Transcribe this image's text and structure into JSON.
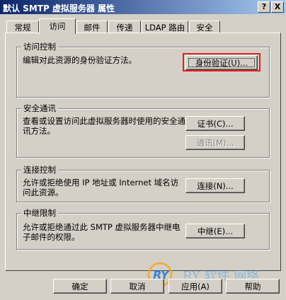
{
  "window": {
    "title": "默认 SMTP 虚拟服务器 属性",
    "help_btn": "?",
    "close_btn": "X"
  },
  "tabs": [
    "常规",
    "访问",
    "邮件",
    "传递",
    "LDAP 路由",
    "安全"
  ],
  "active_tab": "访问",
  "groups": {
    "access_control": {
      "title": "访问控制",
      "desc": "编辑对此资源的身份验证方法。",
      "button": "身份验证(U)..."
    },
    "secure_comm": {
      "title": "安全通讯",
      "desc": "查看或设置访问此虚拟服务器时使用的安全通讯方法。",
      "button1": "证书(C)...",
      "button2": "通讯(M)..."
    },
    "connection_control": {
      "title": "连接控制",
      "desc": "允许或拒绝使用 IP 地址或 Internet 域名访问此资源。",
      "button": "连接(N)..."
    },
    "relay": {
      "title": "中继限制",
      "desc": "允许或拒绝通过此 SMTP 虚拟服务器中继电子邮件的权限。",
      "button": "中继(E)..."
    }
  },
  "footer": {
    "ok": "确定",
    "cancel": "取消",
    "apply": "应用(A)",
    "help": "帮助"
  },
  "watermark": "RY 软件 网络"
}
